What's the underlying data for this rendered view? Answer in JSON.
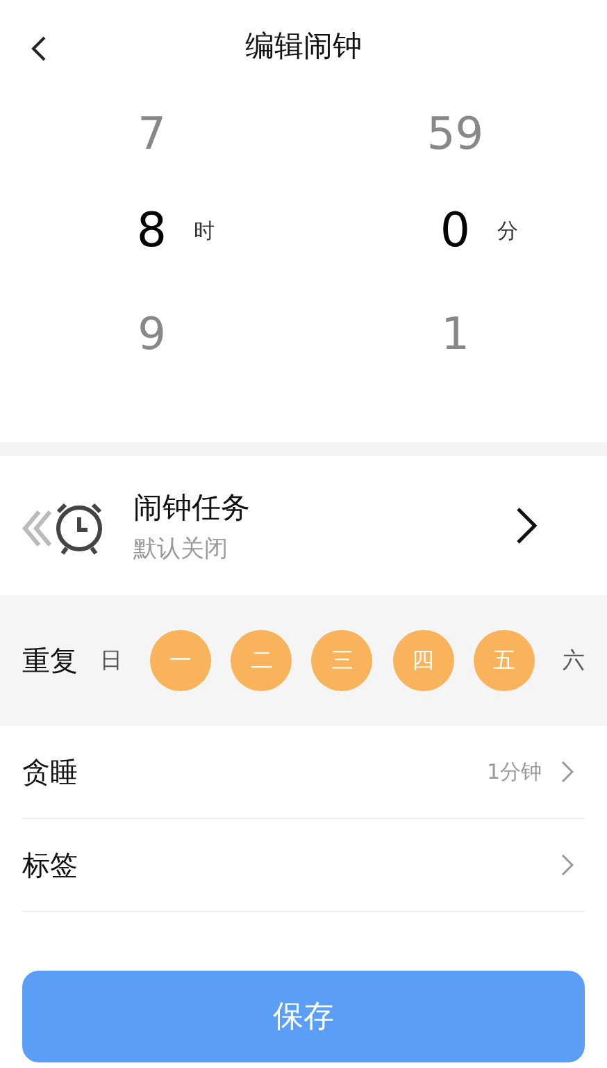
{
  "header": {
    "title": "编辑闹钟"
  },
  "picker": {
    "columns": [
      {
        "unit": "时",
        "prev": "7",
        "value": "8",
        "next": "9"
      },
      {
        "unit": "分",
        "prev": "59",
        "value": "0",
        "next": "1"
      }
    ]
  },
  "task": {
    "title": "闹钟任务",
    "subtitle": "默认关闭"
  },
  "repeat": {
    "label": "重复",
    "days": [
      {
        "label": "日",
        "selected": false
      },
      {
        "label": "一",
        "selected": true
      },
      {
        "label": "二",
        "selected": true
      },
      {
        "label": "三",
        "selected": true
      },
      {
        "label": "四",
        "selected": true
      },
      {
        "label": "五",
        "selected": true
      },
      {
        "label": "六",
        "selected": false
      }
    ]
  },
  "settings": [
    {
      "label": "贪睡",
      "value": "1分钟"
    },
    {
      "label": "标签"
    }
  ],
  "save_button": "保存"
}
